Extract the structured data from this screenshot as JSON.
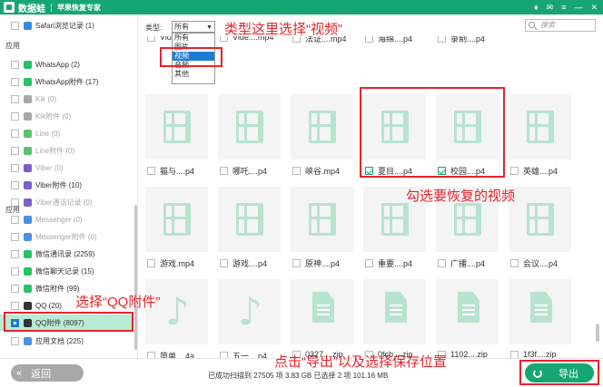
{
  "titlebar": {
    "app_name": "数据蛙",
    "subtitle": "苹果恢复专家",
    "controls": [
      "♦",
      "✉",
      "≡",
      "—",
      "✕"
    ]
  },
  "sidebar": {
    "top_item": {
      "label": "Safari浏览记录 (1)",
      "checked": false,
      "dim": false,
      "icon_color": "#3a88e0"
    },
    "section_1": "应用",
    "section_2": "应用",
    "items": [
      {
        "label": "WhatsApp (2)",
        "checked": false,
        "dim": false,
        "icon_color": "#28c163"
      },
      {
        "label": "WhatsApp附件 (17)",
        "checked": false,
        "dim": false,
        "icon_color": "#28c163"
      },
      {
        "label": "Kik (0)",
        "checked": false,
        "dim": true,
        "icon_color": "#a8a8a8"
      },
      {
        "label": "Kik附件 (0)",
        "checked": false,
        "dim": true,
        "icon_color": "#a8a8a8"
      },
      {
        "label": "Line (0)",
        "checked": false,
        "dim": true,
        "icon_color": "#5bc36d"
      },
      {
        "label": "Line附件 (0)",
        "checked": false,
        "dim": true,
        "icon_color": "#5bc36d"
      },
      {
        "label": "Viber (0)",
        "checked": false,
        "dim": true,
        "icon_color": "#7b60c9"
      },
      {
        "label": "Viber附件 (10)",
        "checked": false,
        "dim": false,
        "icon_color": "#7b60c9"
      },
      {
        "label": "Viber通话记录 (0)",
        "checked": false,
        "dim": true,
        "icon_color": "#7b60c9"
      },
      {
        "label": "Messenger (0)",
        "checked": false,
        "dim": true,
        "icon_color": "#4a90e2"
      },
      {
        "label": "Messenger附件 (0)",
        "checked": false,
        "dim": true,
        "icon_color": "#4a90e2"
      },
      {
        "label": "微信通讯录 (2259)",
        "checked": false,
        "dim": false,
        "icon_color": "#28c163"
      },
      {
        "label": "微信聊天记录 (15)",
        "checked": false,
        "dim": false,
        "icon_color": "#28c163"
      },
      {
        "label": "微信附件 (99)",
        "checked": false,
        "dim": false,
        "icon_color": "#28c163"
      },
      {
        "label": "QQ (20)",
        "checked": false,
        "dim": false,
        "icon_color": "#333333"
      },
      {
        "label": "QQ附件 (8097)",
        "checked": true,
        "dim": false,
        "icon_color": "#333333",
        "selected": true
      }
    ],
    "bottom_item": {
      "label": "应用文档 (225)",
      "checked": false,
      "dim": false,
      "icon_color": "#4a90e2"
    }
  },
  "filter": {
    "type_label": "类型:",
    "selected_type": "所有",
    "options": [
      "所有",
      "图片",
      "视频",
      "音频",
      "其他"
    ],
    "highlighted_option": 2,
    "search_placeholder": "搜索"
  },
  "grid": {
    "partial_row": [
      "Vide...",
      "Vide....mp4",
      "法证....mp4",
      "海绵....p4",
      "录制....p4"
    ],
    "files": [
      {
        "name": "猫与....p4",
        "kind": "video",
        "checked": false
      },
      {
        "name": "哪吒....p4",
        "kind": "video",
        "checked": false
      },
      {
        "name": "峡谷.mp4",
        "kind": "video",
        "checked": false
      },
      {
        "name": "夏目....p4",
        "kind": "video",
        "checked": true
      },
      {
        "name": "校园....p4",
        "kind": "video",
        "checked": true
      },
      {
        "name": "英雄....p4",
        "kind": "video",
        "checked": false
      },
      {
        "name": "游戏.mp4",
        "kind": "video",
        "checked": false
      },
      {
        "name": "游戏....p4",
        "kind": "video",
        "checked": false
      },
      {
        "name": "原神....p4",
        "kind": "video",
        "checked": false
      },
      {
        "name": "重要....p4",
        "kind": "video",
        "checked": false
      },
      {
        "name": "广播....p4",
        "kind": "video",
        "checked": false
      },
      {
        "name": "会议....p4",
        "kind": "video",
        "checked": false
      },
      {
        "name": "简单....4a",
        "kind": "audio",
        "checked": false
      },
      {
        "name": "五一....p4",
        "kind": "audio",
        "checked": false
      },
      {
        "name": "0327....zip",
        "kind": "doc",
        "checked": false
      },
      {
        "name": "0fcb....zip",
        "kind": "doc",
        "checked": false
      },
      {
        "name": "1102....zip",
        "kind": "doc",
        "checked": false
      },
      {
        "name": "1f3f....zip",
        "kind": "doc",
        "checked": false
      }
    ]
  },
  "bottom": {
    "back_label": "返回",
    "status": "已成功扫描到 27505 项 3.83 GB  已选择 2 项 101.16 MB",
    "export_label": "导出"
  },
  "annotations": {
    "a1": "类型这里选择“视频”",
    "a2": "勾选要恢复的视频",
    "a3": "选择“QQ附件”",
    "a4": "点击“导出”以及选择保存位置"
  },
  "colors": {
    "brand": "#17a673",
    "annotation": "#e8232a",
    "selected_row": "#b9ebd3",
    "icon_tint": "#b8e3cf"
  }
}
